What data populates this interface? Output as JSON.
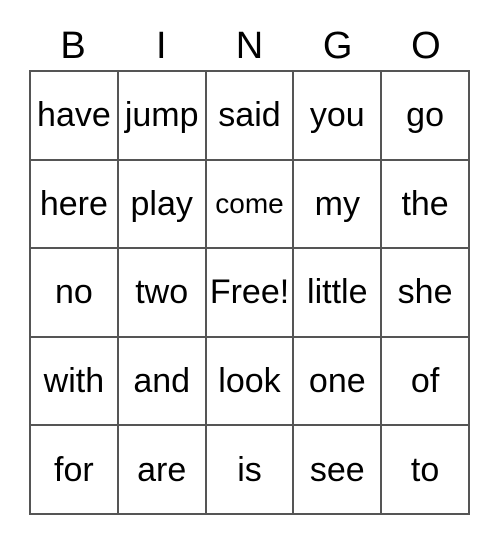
{
  "card": {
    "headers": [
      "B",
      "I",
      "N",
      "G",
      "O"
    ],
    "free_space_label": "Free!",
    "border_color": "#555555",
    "background_color": "#ffffff",
    "text_color": "#000000",
    "rows": [
      [
        "have",
        "jump",
        "said",
        "you",
        "go"
      ],
      [
        "here",
        "play",
        "come",
        "my",
        "the"
      ],
      [
        "no",
        "two",
        "Free!",
        "little",
        "she"
      ],
      [
        "with",
        "and",
        "look",
        "one",
        "of"
      ],
      [
        "for",
        "are",
        "is",
        "see",
        "to"
      ]
    ]
  }
}
